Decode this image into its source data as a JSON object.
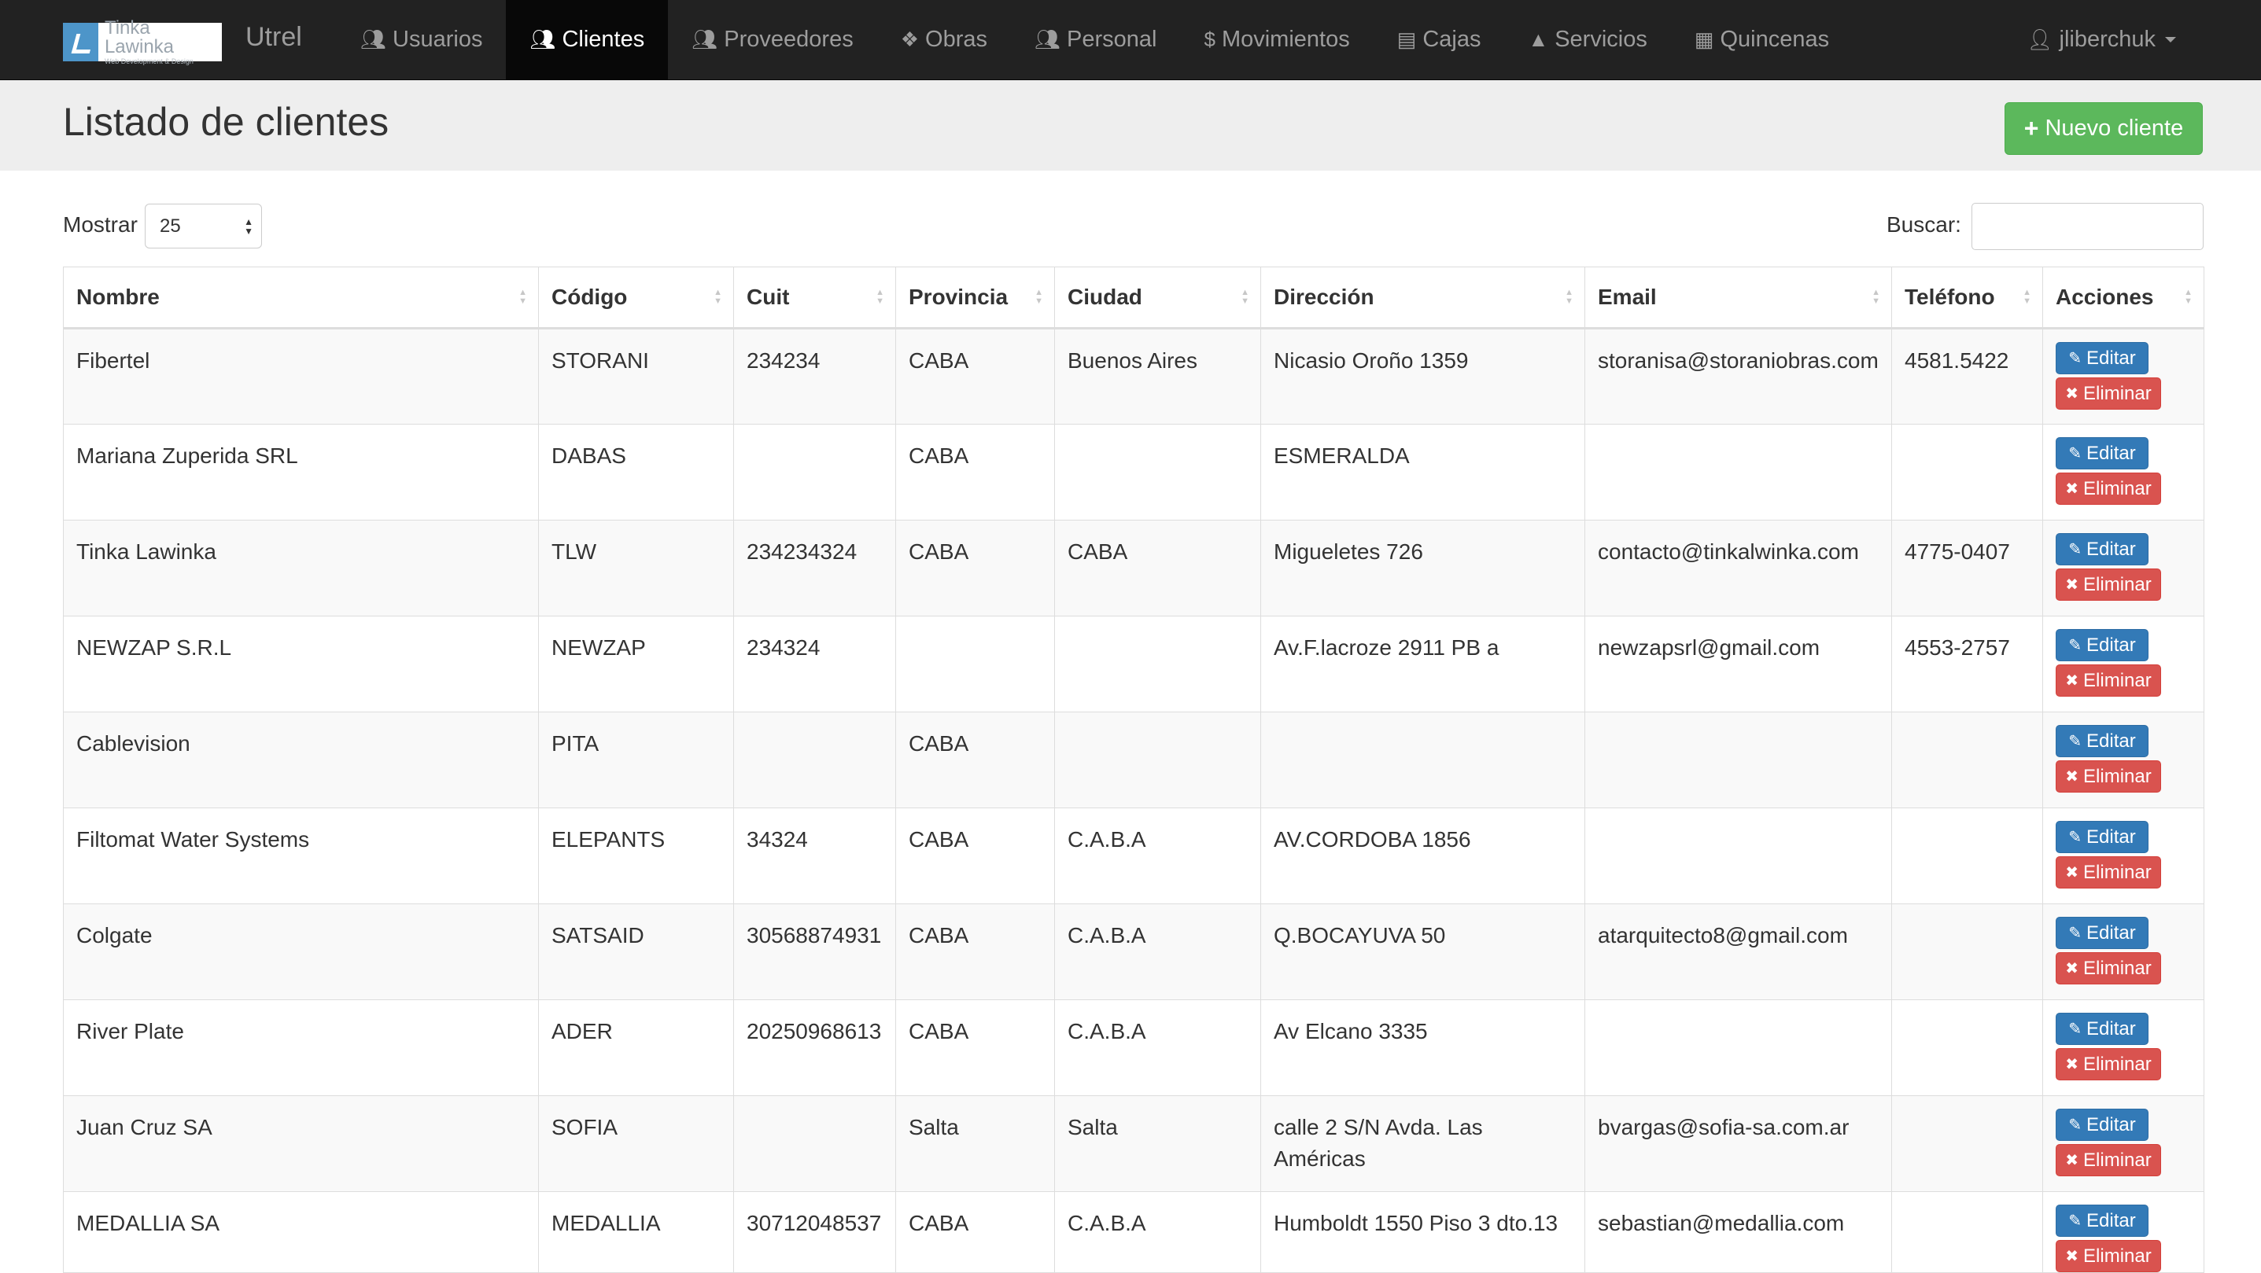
{
  "brand": {
    "logo_text": "Tinka Lawinka",
    "logo_subtext": "Web Development & Design",
    "app_name": "Utrel"
  },
  "nav": {
    "items": [
      {
        "label": "Usuarios",
        "icon": "users-icon",
        "active": false
      },
      {
        "label": "Clientes",
        "icon": "users-icon",
        "active": true
      },
      {
        "label": "Proveedores",
        "icon": "users-icon",
        "active": false
      },
      {
        "label": "Obras",
        "icon": "cubes-icon",
        "active": false
      },
      {
        "label": "Personal",
        "icon": "users-icon",
        "active": false
      },
      {
        "label": "Movimientos",
        "icon": "dollar-icon",
        "active": false
      },
      {
        "label": "Cajas",
        "icon": "archive-icon",
        "active": false
      },
      {
        "label": "Servicios",
        "icon": "tint-icon",
        "active": false
      },
      {
        "label": "Quincenas",
        "icon": "calendar-icon",
        "active": false
      }
    ],
    "user": "jliberchuk"
  },
  "header": {
    "title": "Listado de clientes",
    "new_button": "Nuevo cliente"
  },
  "controls": {
    "show_label": "Mostrar",
    "page_length": "25",
    "search_label": "Buscar:",
    "search_value": ""
  },
  "table": {
    "columns": [
      "Nombre",
      "Código",
      "Cuit",
      "Provincia",
      "Ciudad",
      "Dirección",
      "Email",
      "Teléfono",
      "Acciones"
    ],
    "edit_label": "Editar",
    "delete_label": "Eliminar",
    "rows": [
      [
        "Fibertel",
        "STORANI",
        "234234",
        "CABA",
        "Buenos Aires",
        "Nicasio Oroño 1359",
        "storanisa@storaniobras.com",
        "4581.5422"
      ],
      [
        "Mariana Zuperida SRL",
        "DABAS",
        "",
        "CABA",
        "",
        "ESMERALDA",
        "",
        ""
      ],
      [
        "Tinka Lawinka",
        "TLW",
        "234234324",
        "CABA",
        "CABA",
        "Migueletes 726",
        "contacto@tinkalwinka.com",
        "4775-0407"
      ],
      [
        "NEWZAP S.R.L",
        "NEWZAP",
        "234324",
        "",
        "",
        "Av.F.lacroze 2911 PB a",
        "newzapsrl@gmail.com",
        "4553-2757"
      ],
      [
        "Cablevision",
        "PITA",
        "",
        "CABA",
        "",
        "",
        "",
        ""
      ],
      [
        "Filtomat Water Systems",
        "ELEPANTS",
        "34324",
        "CABA",
        "C.A.B.A",
        "AV.CORDOBA 1856",
        "",
        ""
      ],
      [
        "Colgate",
        "SATSAID",
        "30568874931",
        "CABA",
        "C.A.B.A",
        "Q.BOCAYUVA 50",
        "atarquitecto8@gmail.com",
        ""
      ],
      [
        "River Plate",
        "ADER",
        "20250968613",
        "CABA",
        "C.A.B.A",
        "Av Elcano 3335",
        "",
        ""
      ],
      [
        "Juan Cruz SA",
        "SOFIA",
        "",
        "Salta",
        "Salta",
        "calle 2 S/N Avda. Las Américas",
        "bvargas@sofia-sa.com.ar",
        ""
      ],
      [
        "MEDALLIA SA",
        "MEDALLIA",
        "30712048537",
        "CABA",
        "C.A.B.A",
        "Humboldt 1550 Piso 3 dto.13",
        "sebastian@medallia.com",
        ""
      ]
    ]
  },
  "colors": {
    "navbar_bg": "#222222",
    "nav_active_bg": "#080808",
    "success": "#5cb85c",
    "primary": "#337ab7",
    "danger": "#d9534f"
  }
}
